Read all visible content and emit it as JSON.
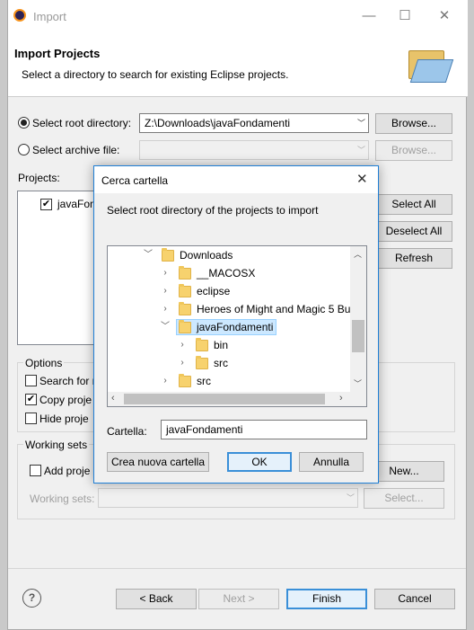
{
  "window": {
    "title": "Import",
    "minimize_icon": "—",
    "maximize_icon": "☐",
    "close_icon": "✕"
  },
  "header": {
    "title": "Import Projects",
    "description": "Select a directory to search for existing Eclipse projects."
  },
  "root_dir": {
    "label": "Select root directory:",
    "value": "Z:\\Downloads\\javaFondamenti",
    "browse": "Browse..."
  },
  "archive": {
    "label": "Select archive file:",
    "value": "",
    "browse": "Browse..."
  },
  "projects": {
    "label": "Projects:",
    "items": [
      {
        "name": "javaFon",
        "checked": true
      }
    ]
  },
  "side_buttons": {
    "select_all": "Select All",
    "deselect_all": "Deselect All",
    "refresh": "Refresh"
  },
  "options": {
    "label": "Options",
    "search_nested": "Search for n",
    "copy_projects": "Copy proje",
    "hide_projects": "Hide proje"
  },
  "working_sets": {
    "label": "Working sets",
    "add": "Add proje",
    "new": "New...",
    "sets_label": "Working sets:",
    "select": "Select..."
  },
  "footer": {
    "help": "?",
    "back": "< Back",
    "next": "Next >",
    "finish": "Finish",
    "cancel": "Cancel"
  },
  "dialog": {
    "title": "Cerca cartella",
    "instruction": "Select root directory of the projects to import",
    "tree": [
      {
        "label": "Downloads",
        "expander": "﹀"
      },
      {
        "label": "__MACOSX",
        "expander": "›"
      },
      {
        "label": "eclipse",
        "expander": "›"
      },
      {
        "label": "Heroes of Might and Magic 5 Bu",
        "expander": "›"
      },
      {
        "label": "javaFondamenti",
        "expander": "﹀"
      },
      {
        "label": "bin",
        "expander": "›"
      },
      {
        "label": "src",
        "expander": "›"
      },
      {
        "label": "src",
        "expander": "›"
      }
    ],
    "folder_label": "Cartella:",
    "folder_value": "javaFondamenti",
    "new_folder": "Crea nuova cartella",
    "ok": "OK",
    "cancel": "Annulla"
  },
  "colors": {
    "accent": "#1f7fd6",
    "selection": "#cce8ff",
    "folder": "#f7d26e"
  }
}
